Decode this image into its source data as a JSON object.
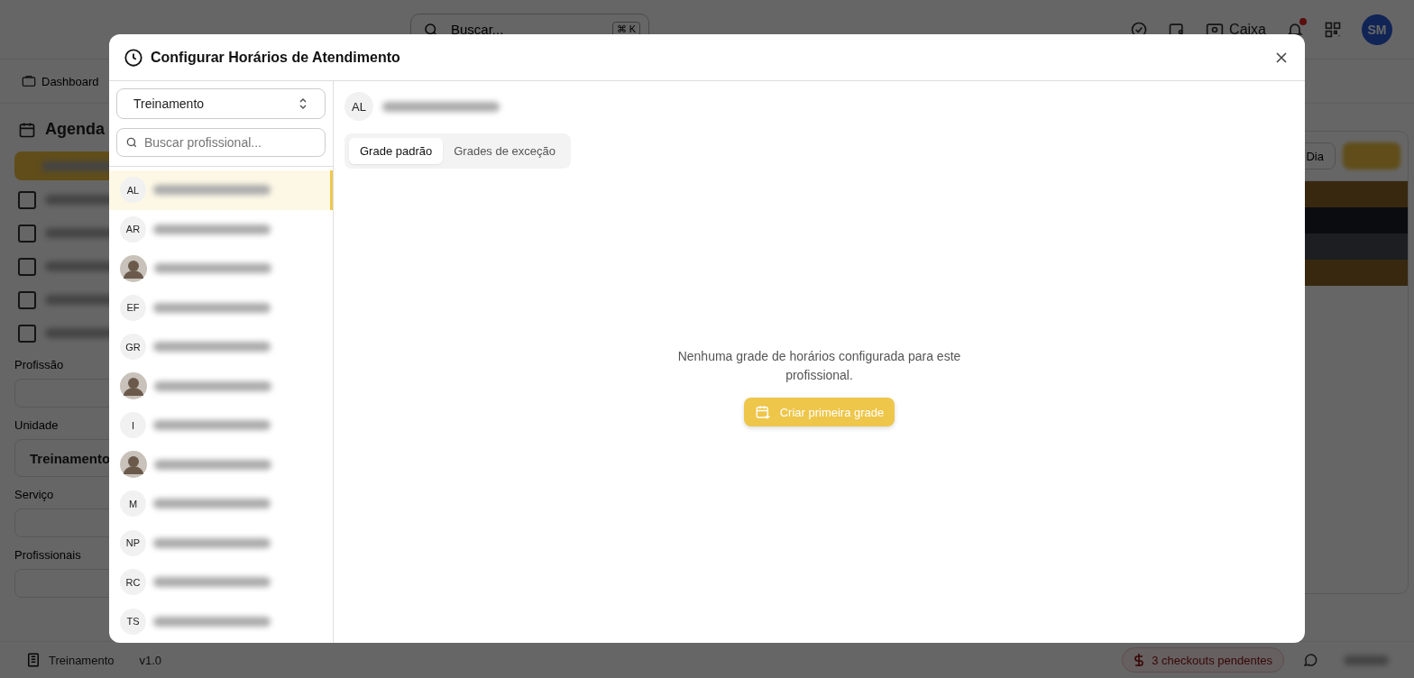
{
  "app": {
    "search": {
      "placeholder": "Buscar...",
      "shortcut": "⌘ K"
    },
    "header_actions": {
      "cash_label": "Caixa",
      "notification_dot": true,
      "user_initials": "SM"
    },
    "breadcrumb": "Dashboard",
    "sidebar": {
      "title": "Agenda",
      "filters": [
        {
          "label": "Profissão"
        },
        {
          "label": "Unidade",
          "value": "Treinamento"
        },
        {
          "label": "Serviço"
        },
        {
          "label": "Profissionais"
        }
      ]
    },
    "calendar": {
      "view_button": "Dia",
      "events": [
        {
          "color": "#37280f"
        },
        {
          "color": "#0b0c0f"
        },
        {
          "color": "#1c1e21"
        },
        {
          "color": "#37280f"
        }
      ]
    },
    "footer": {
      "unit": "Treinamento",
      "version": "v1.0",
      "checkouts": "3 checkouts pendentes"
    }
  },
  "dialog": {
    "title": "Configurar Horários de Atendimento",
    "unit_select": {
      "value": "Treinamento"
    },
    "search": {
      "placeholder": "Buscar profissional..."
    },
    "professionals": [
      {
        "kind": "initials",
        "initials": "AL",
        "selected": true
      },
      {
        "kind": "initials",
        "initials": "AR",
        "selected": false
      },
      {
        "kind": "photo",
        "selected": false
      },
      {
        "kind": "initials",
        "initials": "EF",
        "selected": false
      },
      {
        "kind": "initials",
        "initials": "GR",
        "selected": false
      },
      {
        "kind": "photo",
        "selected": false
      },
      {
        "kind": "initials",
        "initials": "I",
        "selected": false
      },
      {
        "kind": "photo",
        "selected": false
      },
      {
        "kind": "initials",
        "initials": "M",
        "selected": false
      },
      {
        "kind": "initials",
        "initials": "NP",
        "selected": false
      },
      {
        "kind": "initials",
        "initials": "RC",
        "selected": false
      },
      {
        "kind": "initials",
        "initials": "TS",
        "selected": false
      }
    ],
    "current": {
      "initials": "AL"
    },
    "tabs": [
      {
        "label": "Grade padrão",
        "selected": true
      },
      {
        "label": "Grades de exceção",
        "selected": false
      }
    ],
    "empty_message": "Nenhuma grade de horários configurada para este profissional.",
    "create_button": "Criar primeira grade"
  }
}
